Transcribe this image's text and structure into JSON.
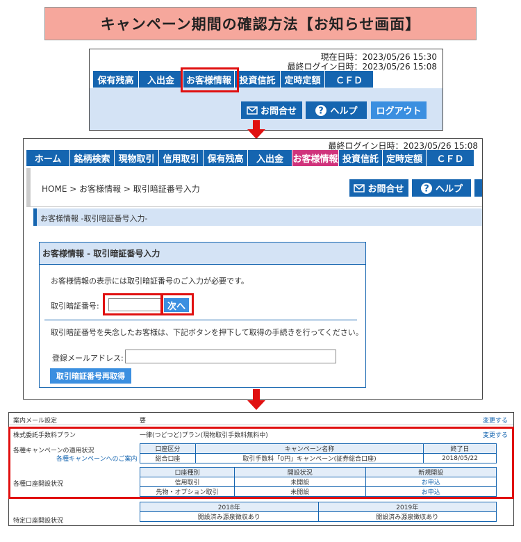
{
  "title": "キャンペーン期間の確認方法【お知らせ画面】",
  "panel1": {
    "current_datetime": "現在日時：2023/05/26 15:30",
    "last_login": "最終ログイン日時：2023/05/26 15:08",
    "nav": [
      "保有残高",
      "入出金",
      "お客様情報",
      "投資信託",
      "定時定額",
      "ＣＦＤ"
    ],
    "contact_label": "お問合せ",
    "help_label": "ヘルプ",
    "logout_label": "ログアウト"
  },
  "panel2": {
    "last_login": "最終ログイン日時：2023/05/26 15:08",
    "nav": [
      "ホーム",
      "銘柄検索",
      "現物取引",
      "信用取引",
      "保有残高",
      "入出金",
      "お客様情報",
      "投資信託",
      "定時定額",
      "ＣＦＤ"
    ],
    "breadcrumb": "HOME > お客様情報 > 取引暗証番号入力",
    "contact_label": "お問合せ",
    "help_label": "ヘルプ",
    "section_title": "お客様情報 -取引暗証番号入力-",
    "box_title": "お客様情報 - 取引暗証番号入力",
    "instruction": "お客様情報の表示には取引暗証番号のご入力が必要です。",
    "pin_label": "取引暗証番号:",
    "pin_value": "",
    "next_label": "次へ",
    "forgot_text": "取引暗証番号を失念したお客様は、下記ボタンを押下して取得の手続きを行ってください。",
    "email_label": "登録メールアドレス:",
    "email_value": "",
    "reissue_label": "取引暗証番号再取得"
  },
  "panel3": {
    "mail_label": "案内メール設定",
    "mail_value": "要",
    "change1": "変更する",
    "plan_label": "株式委託手数料プラン",
    "plan_value": "一律(つどつど)プラン(現物取引手数料無料中)",
    "change2": "変更する",
    "campaign_label": "各種キャンペーンの適用状況",
    "campaign_link": "各種キャンペーンへのご案内",
    "campaign_headers": [
      "口座区分",
      "キャンペーン名称",
      "終了日"
    ],
    "campaign_row": [
      "総合口座",
      "取引手数料「0円」キャンペーン(証券総合口座)",
      "2018/05/22"
    ],
    "account_label": "各種口座開設状況",
    "account_headers": [
      "口座種別",
      "開設状況",
      "新規開設"
    ],
    "account_rows": [
      [
        "信用取引",
        "未開設",
        "お申込"
      ],
      [
        "先物・オプション取引",
        "未開設",
        "お申込"
      ]
    ],
    "special_label": "特定口座開設状況",
    "special_headers": [
      "2018年",
      "2019年"
    ],
    "special_row": [
      "開設済み源泉徴収あり",
      "開設済み源泉徴収あり"
    ]
  }
}
